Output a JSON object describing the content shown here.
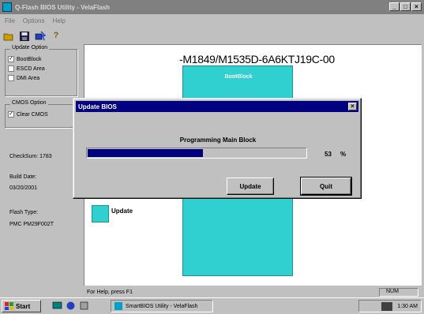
{
  "window": {
    "title": "Q-Flash BIOS Utility - VelaFlash",
    "min": "_",
    "max": "□",
    "close": "×"
  },
  "menu": [
    "File",
    "Options",
    "Help"
  ],
  "toolbar": {
    "icons": [
      "folder-open-icon",
      "save-icon",
      "flash-icon",
      "help-icon"
    ],
    "help_glyph": "?"
  },
  "left_panel": {
    "update_option": {
      "title": "Update Option",
      "items": [
        {
          "label": "BootBlock",
          "checked": true
        },
        {
          "label": "ESCD Area",
          "checked": false
        },
        {
          "label": "DMI Area",
          "checked": false
        }
      ]
    },
    "cmos_option": {
      "title": "CMOS Option",
      "items": [
        {
          "label": "Clear CMOS",
          "checked": true
        }
      ]
    },
    "check_sum": "CheckSum: 1783",
    "build_date_label": "Build Date:",
    "build_date": "03/20/2001",
    "flash_type_label": "Flash Type:",
    "flash_type": "PMC PM29F002T"
  },
  "main": {
    "model_title": "-M1849/M1535D-6A6KTJ19C-00",
    "boot_block_label": "BootBlock",
    "legend_label": "Update"
  },
  "status": {
    "help": "For Help, press F1",
    "mode": "NUM"
  },
  "dialog": {
    "title": "Update BIOS",
    "close": "×",
    "progress_label": "Programming Main Block",
    "progress_percent": 53,
    "progress_value_text": "53",
    "progress_unit": "%",
    "update_button": "Update",
    "quit_button": "Quit"
  },
  "taskbar": {
    "start": "Start",
    "task_item": "SmartBIOS Utility - VelaFlash",
    "clock": "1:30 AM"
  },
  "colors": {
    "title_bar": "#808080",
    "dialog_title_bar": "#000080",
    "progress_fill": "#000080",
    "bios_block": "#30d0d0",
    "window_bg": "#c0c0c0"
  }
}
